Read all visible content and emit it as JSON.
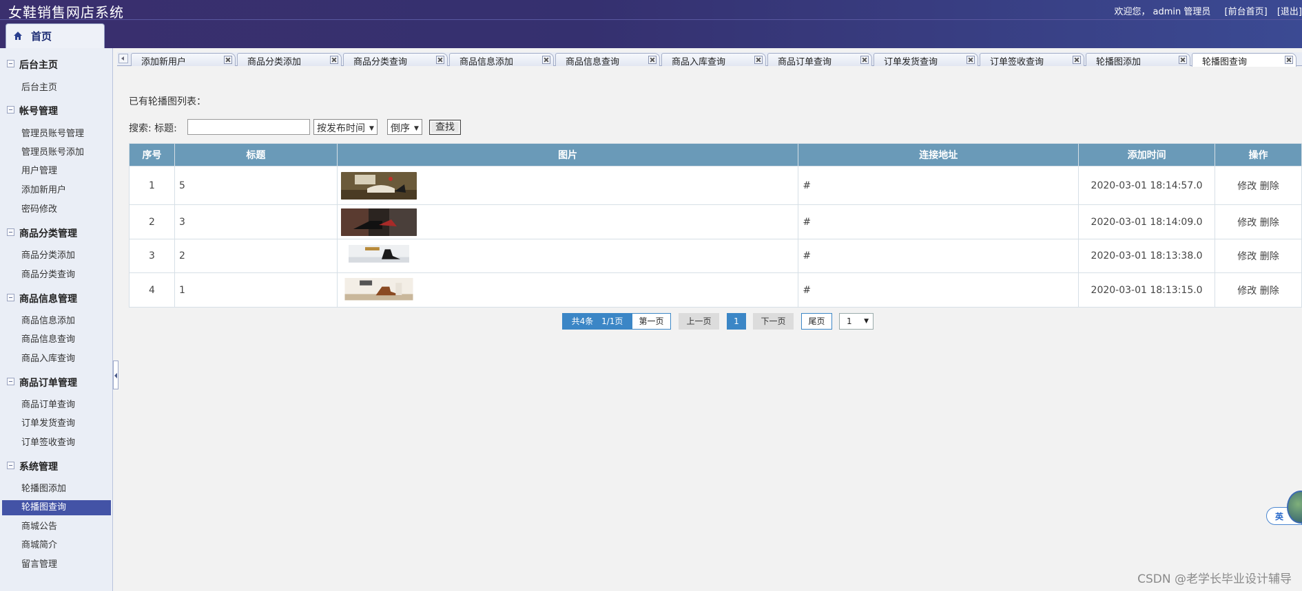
{
  "header": {
    "title": "女鞋销售网店系统",
    "welcome": "欢迎您，",
    "user": "admin 管理员",
    "front_link": "[前台首页]",
    "logout_link": "[退出]"
  },
  "home_tab": {
    "label": "首页"
  },
  "sidebar": {
    "sections": [
      {
        "title": "后台主页",
        "items": [
          "后台主页"
        ]
      },
      {
        "title": "帐号管理",
        "items": [
          "管理员账号管理",
          "管理员账号添加",
          "用户管理",
          "添加新用户",
          "密码修改"
        ]
      },
      {
        "title": "商品分类管理",
        "items": [
          "商品分类添加",
          "商品分类查询"
        ]
      },
      {
        "title": "商品信息管理",
        "items": [
          "商品信息添加",
          "商品信息查询",
          "商品入库查询"
        ]
      },
      {
        "title": "商品订单管理",
        "items": [
          "商品订单查询",
          "订单发货查询",
          "订单签收查询"
        ]
      },
      {
        "title": "系统管理",
        "items": [
          "轮播图添加",
          "轮播图查询",
          "商城公告",
          "商城简介",
          "留言管理"
        ]
      }
    ],
    "active_item": "轮播图查询"
  },
  "tabs": [
    "添加新用户",
    "商品分类添加",
    "商品分类查询",
    "商品信息添加",
    "商品信息查询",
    "商品入库查询",
    "商品订单查询",
    "订单发货查询",
    "订单签收查询",
    "轮播图添加",
    "轮播图查询"
  ],
  "active_tab": "轮播图查询",
  "list_title": "已有轮播图列表：",
  "search": {
    "label": "搜索: 标题:",
    "value": "",
    "sort_field": "按发布时间",
    "sort_order": "倒序",
    "button": "查找"
  },
  "table": {
    "headers": [
      "序号",
      "标题",
      "图片",
      "连接地址",
      "添加时间",
      "操作"
    ],
    "rows": [
      {
        "no": "1",
        "title": "5",
        "link": "#",
        "time": "2020-03-01 18:14:57.0",
        "edit": "修改",
        "del": "删除"
      },
      {
        "no": "2",
        "title": "3",
        "link": "#",
        "time": "2020-03-01 18:14:09.0",
        "edit": "修改",
        "del": "删除"
      },
      {
        "no": "3",
        "title": "2",
        "link": "#",
        "time": "2020-03-01 18:13:38.0",
        "edit": "修改",
        "del": "删除"
      },
      {
        "no": "4",
        "title": "1",
        "link": "#",
        "time": "2020-03-01 18:13:15.0",
        "edit": "修改",
        "del": "删除"
      }
    ]
  },
  "pagination": {
    "total": "共4条",
    "pages": "1/1页",
    "first": "第一页",
    "prev": "上一页",
    "current": "1",
    "next": "下一页",
    "last": "尾页",
    "jump_value": "1"
  },
  "ime": {
    "label": "英"
  },
  "watermark": "CSDN @老学长毕业设计辅导",
  "colors": {
    "header_bg": "#3a2f6e",
    "table_header": "#6a9ab8",
    "active_item": "#4353a6",
    "pager_blue": "#3b86c6"
  }
}
